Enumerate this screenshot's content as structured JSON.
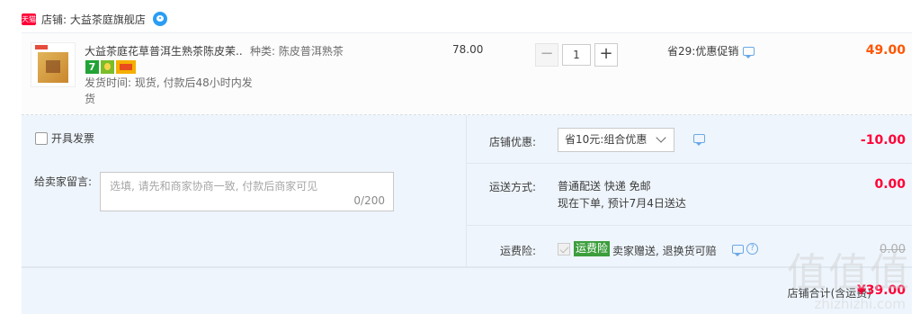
{
  "shop": {
    "badge": "天猫",
    "name": "店铺: 大益茶庭旗舰店",
    "chat_icon": "wangwang-chat-icon"
  },
  "item": {
    "title": "大益茶庭花草普洱生熟茶陈皮茉...",
    "sku": "种类: 陈皮普洱熟茶",
    "ship_time": "发货时间: 现货, 付款后48小时内发货",
    "unit_price": "78.00",
    "quantity": "1",
    "saving": "省29:优惠促销",
    "total": "49.00",
    "promo_icons": [
      "7-day-return-icon",
      "guarantee-icon",
      "card-pay-icon"
    ],
    "colors": {
      "price": "#ff5500"
    }
  },
  "order": {
    "invoice_label": "开具发票",
    "message_label": "给卖家留言:",
    "message_placeholder": "选填, 请先和商家协商一致, 付款后商家可见",
    "message_count": "0/200",
    "discount_label": "店铺优惠:",
    "discount_selected": "省10元:组合优惠",
    "discount_amount": "-10.00",
    "shipping_label": "运送方式:",
    "shipping_method": "普通配送 快递 免邮",
    "shipping_eta": "现在下单, 预计7月4日送达",
    "shipping_amount": "0.00",
    "insurance_label": "运费险:",
    "insurance_tag": "运费险",
    "insurance_text": "卖家赠送, 退换货可赔",
    "insurance_amount": "0.00",
    "colors": {
      "amount": "#ff0036",
      "insurance_tag": "#3c9e3c"
    }
  },
  "summary": {
    "label": "店铺合计(含运费)",
    "amount": "¥39.00"
  },
  "watermark": {
    "chars": "值值值",
    "url": "zhizhizhi.com"
  }
}
